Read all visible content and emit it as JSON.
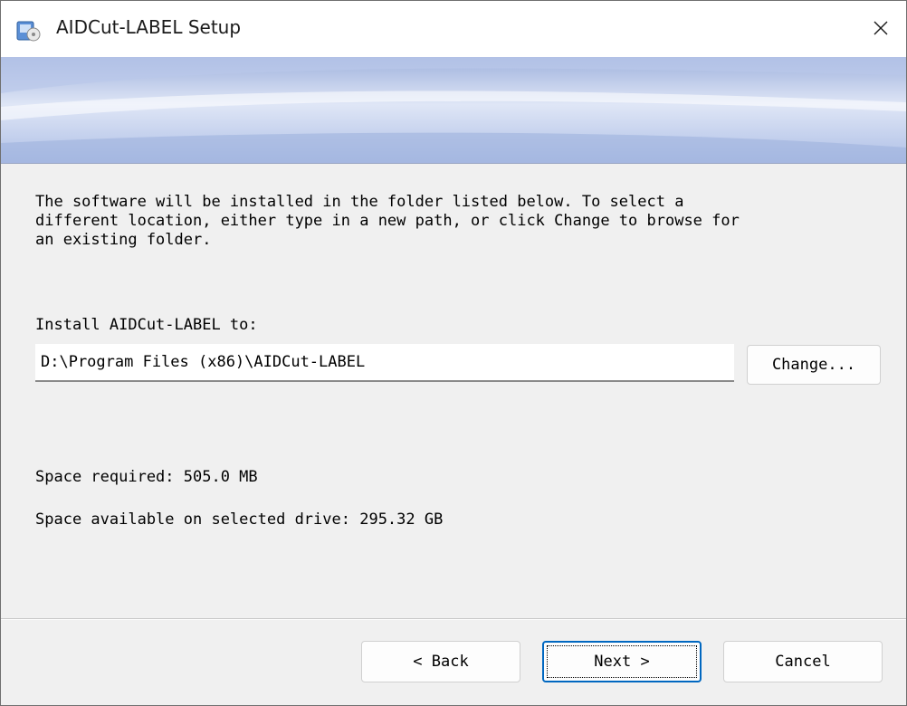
{
  "window": {
    "title": "AIDCut-LABEL Setup",
    "close_label": "×"
  },
  "content": {
    "description": "The software will be installed in the folder listed below. To select a\ndifferent location, either type in a new path, or click Change to browse for\nan existing folder.",
    "install_label": "Install AIDCut-LABEL to:",
    "install_path": "D:\\Program Files (x86)\\AIDCut-LABEL",
    "change_button": "Change...",
    "space_required": "Space required: 505.0 MB",
    "space_available": "Space available on selected drive: 295.32 GB"
  },
  "footer": {
    "back_button": "< Back",
    "next_button": "Next >",
    "cancel_button": "Cancel"
  },
  "colors": {
    "accent": "#0067c0",
    "banner_top": "#9fb2dd",
    "banner_mid": "#dfe6f6"
  }
}
